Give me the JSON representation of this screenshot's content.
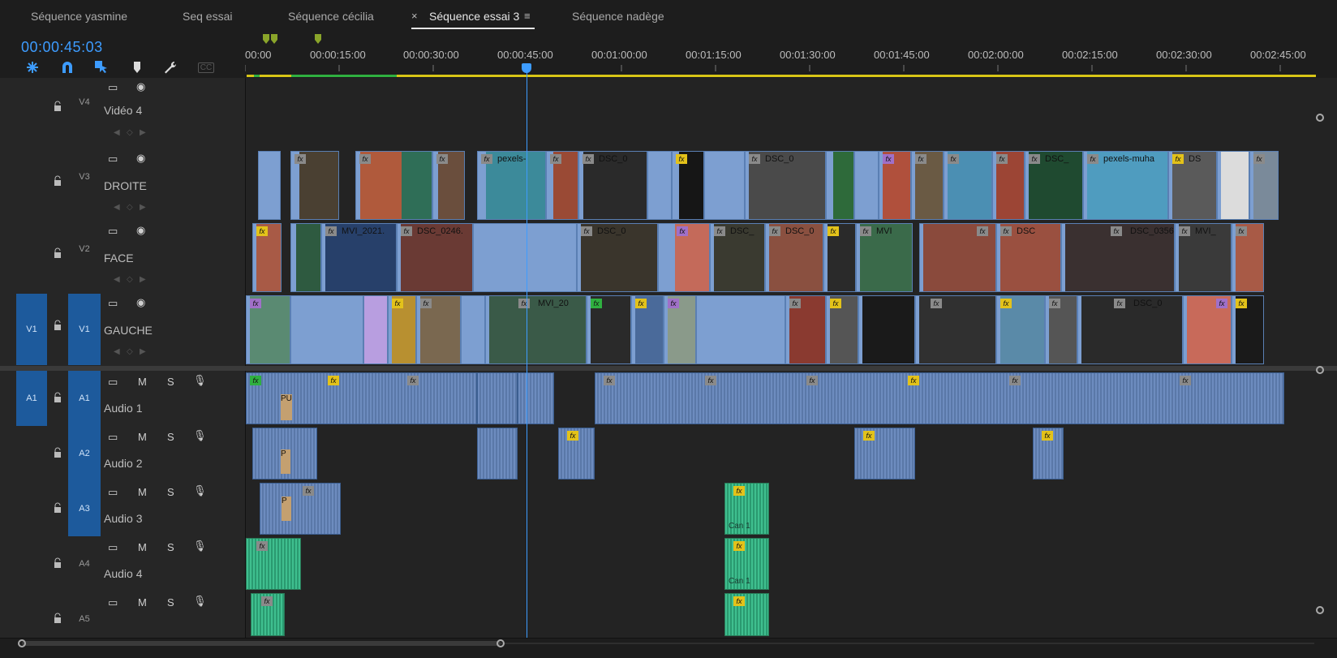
{
  "tabs": [
    {
      "label": "Séquence yasmine",
      "active": false
    },
    {
      "label": "Seq essai",
      "active": false
    },
    {
      "label": "Séquence cécilia",
      "active": false
    },
    {
      "label": "Séquence essai 3",
      "active": true
    },
    {
      "label": "Séquence nadège",
      "active": false
    }
  ],
  "tab_close": "×",
  "tab_menu": "≡",
  "timecode": "00:00:45:03",
  "toolbar": {
    "icons": [
      "nest-icon",
      "snap-icon",
      "linked-selection-icon",
      "marker-icon",
      "wrench-icon",
      "captions-icon"
    ],
    "captions_label": "CC"
  },
  "ruler": {
    "labels": [
      "00:00",
      "00:00:15:00",
      "00:00:30:00",
      "00:00:45:00",
      "00:01:00:00",
      "00:01:15:00",
      "00:01:30:00",
      "00:01:45:00",
      "00:02:00:00",
      "00:02:15:00",
      "00:02:30:00",
      "00:02:45:00"
    ]
  },
  "tracks": {
    "video": [
      {
        "id": "V4",
        "name": "Vidéo 4"
      },
      {
        "id": "V3",
        "name": "DROITE"
      },
      {
        "id": "V2",
        "name": "FACE"
      },
      {
        "id": "V1",
        "name": "GAUCHE",
        "source": "V1"
      }
    ],
    "audio": [
      {
        "id": "A1",
        "name": "Audio 1",
        "source": "A1"
      },
      {
        "id": "A2",
        "name": "Audio 2"
      },
      {
        "id": "A3",
        "name": "Audio 3"
      },
      {
        "id": "A4",
        "name": "Audio 4"
      },
      {
        "id": "A5",
        "name": ""
      }
    ],
    "audio_buttons": {
      "mute": "M",
      "solo": "S"
    }
  },
  "clips": {
    "v3_labels": [
      "pexels-",
      "DSC_0",
      "DSC_0",
      "DSC_",
      "pexels-muha",
      "DS"
    ],
    "v2_labels": [
      "MVI_2021.",
      "DSC_0246.",
      "DSC_0",
      "DSC_",
      "DSC_0",
      "MVI",
      "DSC",
      "DSC_0356",
      "MVI_"
    ],
    "v1_labels": [
      "MVI_20",
      "DSC_0"
    ],
    "audio_labels": [
      "PU",
      "P",
      "P",
      "Can 1",
      "Can 1"
    ],
    "fx_label": "fx"
  },
  "colors": {
    "accent": "#3d9cff",
    "video_clip": "#7d9fd1",
    "audio_clip": "#6d8cbf",
    "green_clip": "#3fbf8f",
    "target_blue": "#1d5a9c",
    "workbar": "#d8c516"
  }
}
